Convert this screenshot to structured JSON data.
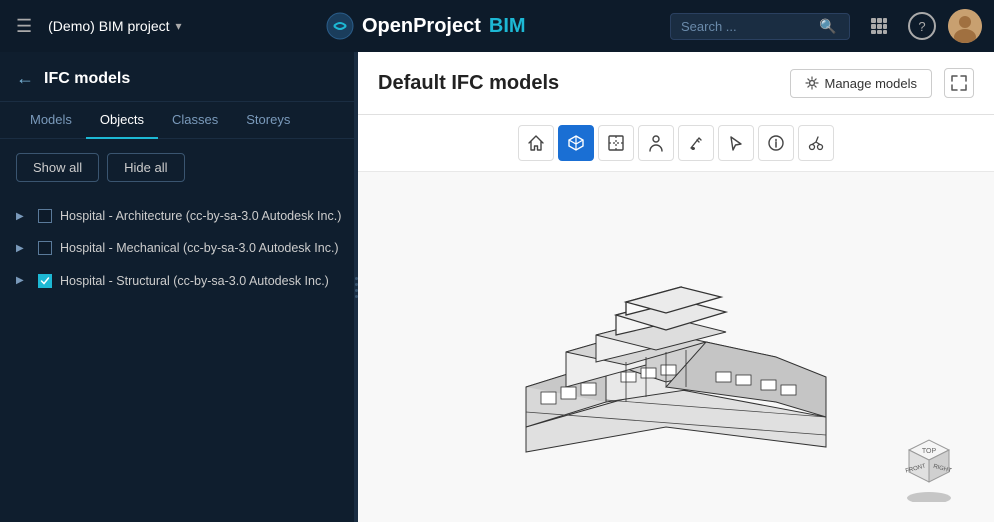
{
  "app": {
    "title": "OpenProject",
    "bim": "BIM",
    "project_name": "(Demo) BIM project"
  },
  "navbar": {
    "project_label": "(Demo) BIM project",
    "search_placeholder": "Search ...",
    "search_label": "Search",
    "help_icon": "?",
    "grid_icon": "⠿"
  },
  "sidebar": {
    "back_label": "←",
    "title": "IFC models",
    "tabs": [
      {
        "id": "models",
        "label": "Models",
        "active": false
      },
      {
        "id": "objects",
        "label": "Objects",
        "active": true
      },
      {
        "id": "classes",
        "label": "Classes",
        "active": false
      },
      {
        "id": "storeys",
        "label": "Storeys",
        "active": false
      }
    ],
    "show_all_label": "Show all",
    "hide_all_label": "Hide all",
    "models": [
      {
        "id": 1,
        "name": "Hospital - Architecture (cc-by-sa-3.0 Autodesk Inc.)",
        "checked": false,
        "expanded": false
      },
      {
        "id": 2,
        "name": "Hospital - Mechanical (cc-by-sa-3.0 Autodesk Inc.)",
        "checked": false,
        "expanded": false
      },
      {
        "id": 3,
        "name": "Hospital - Structural (cc-by-sa-3.0 Autodesk Inc.)",
        "checked": true,
        "expanded": false
      }
    ]
  },
  "content": {
    "title": "Default IFC models",
    "manage_models_label": "Manage models",
    "toolbar_buttons": [
      {
        "id": "home",
        "icon": "⌂",
        "tooltip": "Home view",
        "active": false
      },
      {
        "id": "3d",
        "icon": "⬛",
        "tooltip": "3D view",
        "active": true
      },
      {
        "id": "section",
        "icon": "⊡",
        "tooltip": "Section",
        "active": false
      },
      {
        "id": "user",
        "icon": "👤",
        "tooltip": "First person",
        "active": false
      },
      {
        "id": "paint",
        "icon": "🖌",
        "tooltip": "Paint",
        "active": false
      },
      {
        "id": "select",
        "icon": "↖",
        "tooltip": "Select",
        "active": false
      },
      {
        "id": "info",
        "icon": "ℹ",
        "tooltip": "Info",
        "active": false
      },
      {
        "id": "cut",
        "icon": "✂",
        "tooltip": "Cut",
        "active": false
      }
    ]
  },
  "colors": {
    "accent": "#1db8d4",
    "active_btn": "#1a6fd4",
    "dark_bg": "#0d1b2a",
    "sidebar_bg": "#0f1e2e"
  }
}
